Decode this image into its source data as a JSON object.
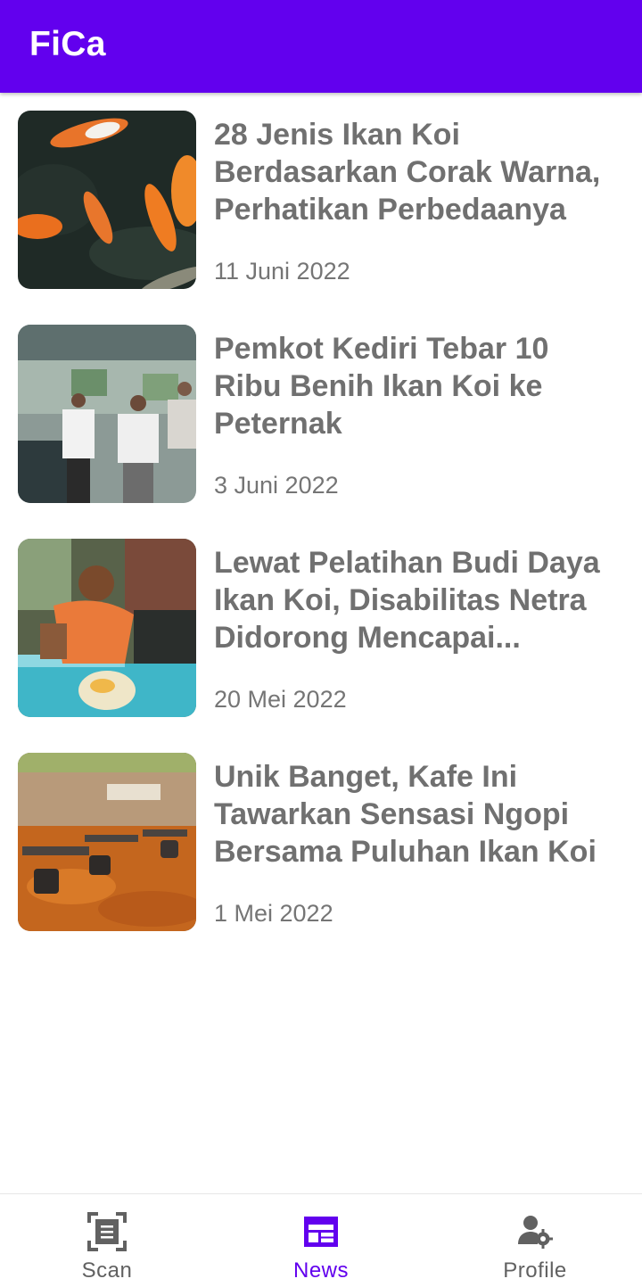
{
  "app": {
    "title": "FiCa"
  },
  "news": [
    {
      "title": "28 Jenis Ikan Koi Berdasarkan Corak Warna, Perhatikan Perbedaanya",
      "date": "11 Juni 2022",
      "image": "koi-fish-photo"
    },
    {
      "title": "Pemkot Kediri Tebar 10 Ribu Benih Ikan Koi ke Peternak",
      "date": "3 Juni 2022",
      "image": "officials-at-fish-farm-photo"
    },
    {
      "title": "Lewat Pelatihan Budi Daya Ikan Koi, Disabilitas Netra Didorong Mencapai...",
      "date": "20 Mei 2022",
      "image": "man-holding-koi-photo"
    },
    {
      "title": "Unik Banget, Kafe Ini Tawarkan Sensasi Ngopi Bersama Puluhan Ikan Koi",
      "date": "1 Mei 2022",
      "image": "koi-cafe-photo"
    }
  ],
  "bottom_nav": {
    "items": [
      {
        "label": "Scan",
        "icon": "scan-icon",
        "active": false
      },
      {
        "label": "News",
        "icon": "news-icon",
        "active": true
      },
      {
        "label": "Profile",
        "icon": "profile-settings-icon",
        "active": false
      }
    ]
  },
  "colors": {
    "primary": "#6200ee",
    "text_title": "#707070",
    "text_date": "#757575",
    "nav_inactive": "#616161"
  }
}
